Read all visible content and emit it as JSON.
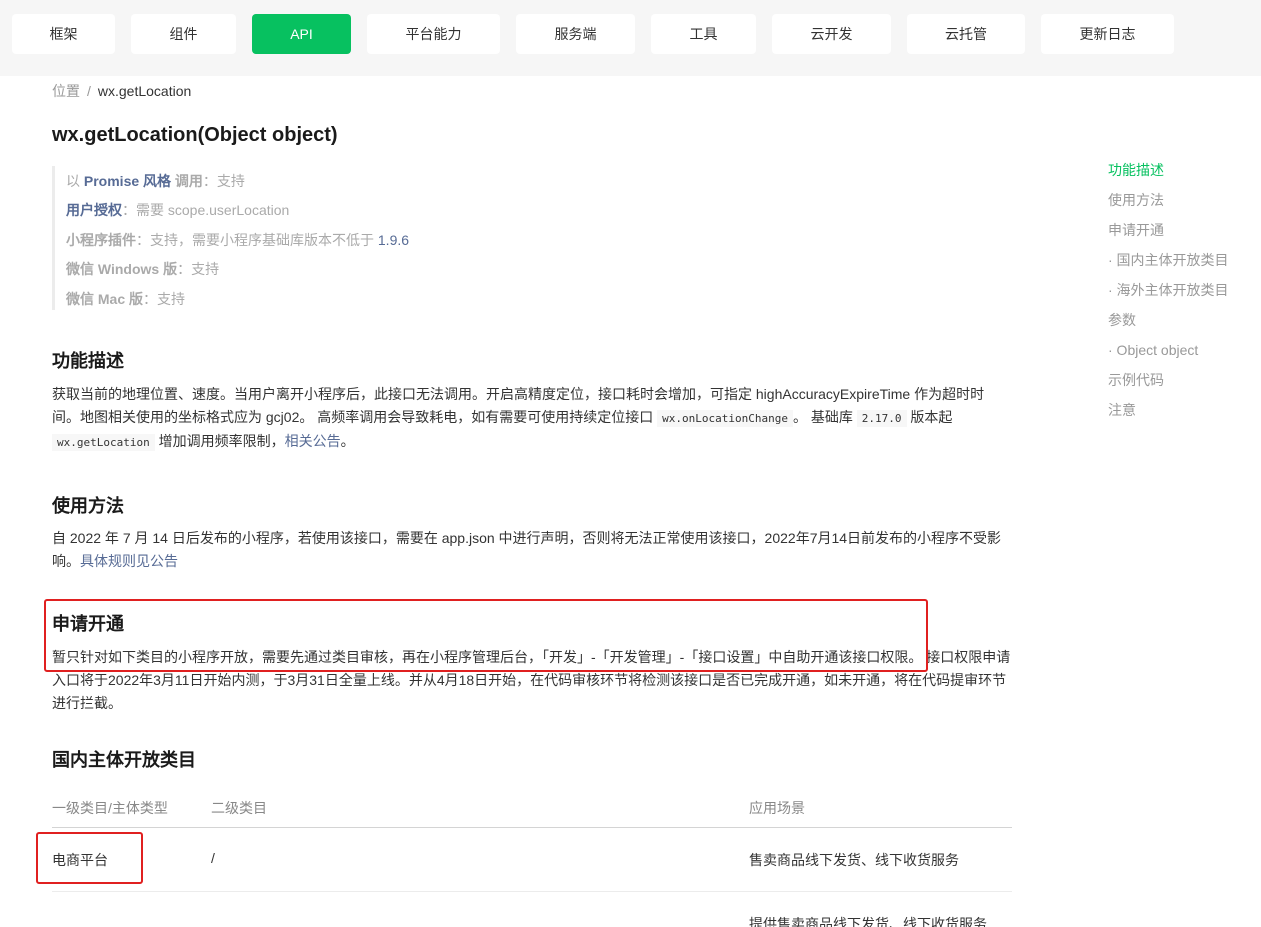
{
  "nav": {
    "tabs": [
      "框架",
      "组件",
      "API",
      "平台能力",
      "服务端",
      "工具",
      "云开发",
      "云托管",
      "更新日志"
    ],
    "active": "API",
    "accent_color": "#07c160"
  },
  "breadcrumb": {
    "parent": "位置",
    "separator": "/",
    "current": "wx.getLocation"
  },
  "title": "wx.getLocation(Object object)",
  "info": {
    "promise_prefix": "以",
    "promise_keyword": "Promise 风格",
    "promise_suffix": "调用",
    "promise_value": "支持",
    "auth_label": "用户授权",
    "auth_value": "需要 scope.userLocation",
    "plugin_label": "小程序插件",
    "plugin_value": "支持，需要小程序基础库版本不低于",
    "plugin_version": "1.9.6",
    "windows_label": "微信 Windows 版",
    "windows_value": "支持",
    "mac_label": "微信 Mac 版",
    "mac_value": "支持",
    "colon": "："
  },
  "sections": {
    "desc": {
      "title": "功能描述",
      "text1": "获取当前的地理位置、速度。当用户离开小程序后，此接口无法调用。开启高精度定位，接口耗时会增加，可指定 highAccuracyExpireTime 作为超时时间。地图相关使用的坐标格式应为 gcj02。 高频率调用会导致耗电，如有需要可使用持续定位接口",
      "code1": "wx.onLocationChange",
      "text2": "。 基础库",
      "code2": "2.17.0",
      "text3": "版本起",
      "code3": "wx.getLocation",
      "text4": "增加调用频率限制，",
      "link": "相关公告",
      "text5": "。"
    },
    "usage": {
      "title": "使用方法",
      "text": "自 2022 年 7 月 14 日后发布的小程序，若使用该接口，需要在 app.json 中进行声明，否则将无法正常使用该接口，2022年7月14日前发布的小程序不受影响。",
      "link": "具体规则见公告"
    },
    "apply": {
      "title": "申请开通",
      "text": "暂只针对如下类目的小程序开放，需要先通过类目审核，再在小程序管理后台，「开发」-「开发管理」-「接口设置」中自助开通该接口权限。 接口权限申请入口将于2022年3月11日开始内测，于3月31日全量上线。并从4月18日开始，在代码审核环节将检测该接口是否已完成开通，如未开通，将在代码提审环节进行拦截。"
    },
    "domestic": {
      "title": "国内主体开放类目",
      "columns": [
        "一级类目/主体类型",
        "二级类目",
        "应用场景"
      ],
      "rows": [
        {
          "cat1": "电商平台",
          "cat2": "/",
          "scene": "售卖商品线下发货、线下收货服务"
        },
        {
          "scene": "提供售卖商品线下发货、线下收货服务"
        }
      ]
    }
  },
  "toc": {
    "items": [
      "功能描述",
      "使用方法",
      "申请开通",
      "· 国内主体开放类目",
      "· 海外主体开放类目",
      "参数",
      "· Object object",
      "示例代码",
      "注意"
    ],
    "active": "功能描述"
  },
  "highlight_color": "#e02020"
}
